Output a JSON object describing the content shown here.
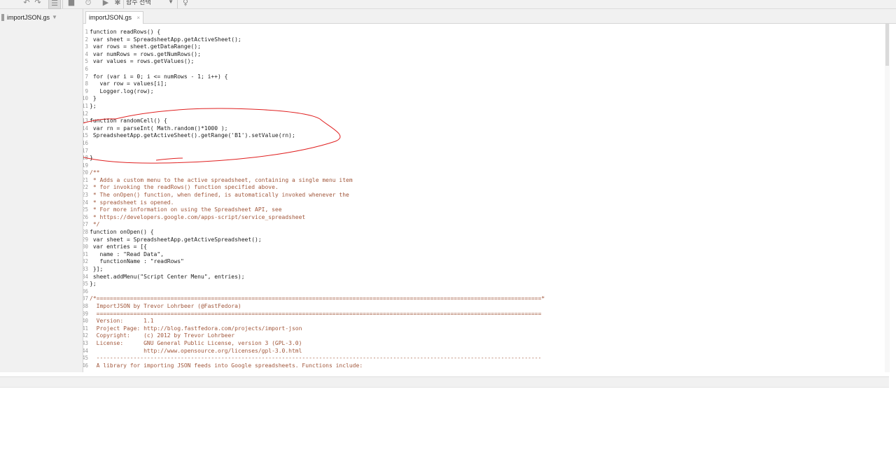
{
  "toolbar": {
    "buttons": [
      {
        "name": "undo-icon",
        "glyph": "↶"
      },
      {
        "name": "redo-icon",
        "glyph": "↷"
      },
      {
        "name": "indent-icon",
        "glyph": "☰"
      },
      {
        "name": "save-icon",
        "glyph": "■"
      },
      {
        "name": "triggers-icon",
        "glyph": "⏱"
      },
      {
        "name": "run-icon",
        "glyph": "▶"
      },
      {
        "name": "debug-icon",
        "glyph": "✱"
      },
      {
        "name": "lightbulb-icon",
        "glyph": "♀"
      }
    ],
    "function_select": "함수 선택"
  },
  "sidebar": {
    "files": [
      {
        "label": "importJSON.gs",
        "caret": "▼"
      }
    ]
  },
  "tabs": [
    {
      "label": "importJSON.gs",
      "close": "×"
    }
  ],
  "editor": {
    "lines": [
      {
        "n": "1",
        "t": "function readRows() {",
        "c": false
      },
      {
        "n": "2",
        "t": " var sheet = SpreadsheetApp.getActiveSheet();",
        "c": false
      },
      {
        "n": "3",
        "t": " var rows = sheet.getDataRange();",
        "c": false
      },
      {
        "n": "4",
        "t": " var numRows = rows.getNumRows();",
        "c": false
      },
      {
        "n": "5",
        "t": " var values = rows.getValues();",
        "c": false
      },
      {
        "n": "6",
        "t": "",
        "c": false
      },
      {
        "n": "7",
        "t": " for (var i = 0; i <= numRows - 1; i++) {",
        "c": false
      },
      {
        "n": "8",
        "t": "   var row = values[i];",
        "c": false
      },
      {
        "n": "9",
        "t": "   Logger.log(row);",
        "c": false
      },
      {
        "n": "10",
        "t": " }",
        "c": false
      },
      {
        "n": "11",
        "t": "};",
        "c": false
      },
      {
        "n": "12",
        "t": "",
        "c": false
      },
      {
        "n": "13",
        "t": "function randomCell() {",
        "c": false
      },
      {
        "n": "14",
        "t": " var rn = parseInt( Math.random()*1000 );",
        "c": false
      },
      {
        "n": "15",
        "t": " SpreadsheetApp.getActiveSheet().getRange('B1').setValue(rn);",
        "c": false
      },
      {
        "n": "16",
        "t": "",
        "c": false
      },
      {
        "n": "17",
        "t": "",
        "c": false
      },
      {
        "n": "18",
        "t": "}",
        "c": false
      },
      {
        "n": "19",
        "t": "",
        "c": false
      },
      {
        "n": "20",
        "t": "/**",
        "c": true
      },
      {
        "n": "21",
        "t": " * Adds a custom menu to the active spreadsheet, containing a single menu item",
        "c": true
      },
      {
        "n": "22",
        "t": " * for invoking the readRows() function specified above.",
        "c": true
      },
      {
        "n": "23",
        "t": " * The onOpen() function, when defined, is automatically invoked whenever the",
        "c": true
      },
      {
        "n": "24",
        "t": " * spreadsheet is opened.",
        "c": true
      },
      {
        "n": "25",
        "t": " * For more information on using the Spreadsheet API, see",
        "c": true
      },
      {
        "n": "26",
        "t": " * https://developers.google.com/apps-script/service_spreadsheet",
        "c": true
      },
      {
        "n": "27",
        "t": " */",
        "c": true
      },
      {
        "n": "28",
        "t": "function onOpen() {",
        "c": false
      },
      {
        "n": "29",
        "t": " var sheet = SpreadsheetApp.getActiveSpreadsheet();",
        "c": false
      },
      {
        "n": "30",
        "t": " var entries = [{",
        "c": false
      },
      {
        "n": "31",
        "t": "   name : \"Read Data\",",
        "c": false
      },
      {
        "n": "32",
        "t": "   functionName : \"readRows\"",
        "c": false
      },
      {
        "n": "33",
        "t": " }];",
        "c": false
      },
      {
        "n": "34",
        "t": " sheet.addMenu(\"Script Center Menu\", entries);",
        "c": false
      },
      {
        "n": "35",
        "t": "};",
        "c": false
      },
      {
        "n": "36",
        "t": "",
        "c": false
      },
      {
        "n": "37",
        "t": "/*====================================================================================================================================*",
        "c": true
      },
      {
        "n": "38",
        "t": "  ImportJSON by Trevor Lohrbeer (@FastFedora)",
        "c": true
      },
      {
        "n": "39",
        "t": "  ====================================================================================================================================",
        "c": true
      },
      {
        "n": "40",
        "t": "  Version:      1.1",
        "c": true
      },
      {
        "n": "41",
        "t": "  Project Page: http://blog.fastfedora.com/projects/import-json",
        "c": true
      },
      {
        "n": "42",
        "t": "  Copyright:    (c) 2012 by Trevor Lohrbeer",
        "c": true
      },
      {
        "n": "43",
        "t": "  License:      GNU General Public License, version 3 (GPL-3.0)",
        "c": true
      },
      {
        "n": "44",
        "t": "                http://www.opensource.org/licenses/gpl-3.0.html",
        "c": true
      },
      {
        "n": "45",
        "t": "  ------------------------------------------------------------------------------------------------------------------------------------",
        "c": true
      },
      {
        "n": "46",
        "t": "  A library for importing JSON feeds into Google spreadsheets. Functions include:",
        "c": true
      }
    ]
  },
  "annotation": {
    "color": "#e02020"
  }
}
